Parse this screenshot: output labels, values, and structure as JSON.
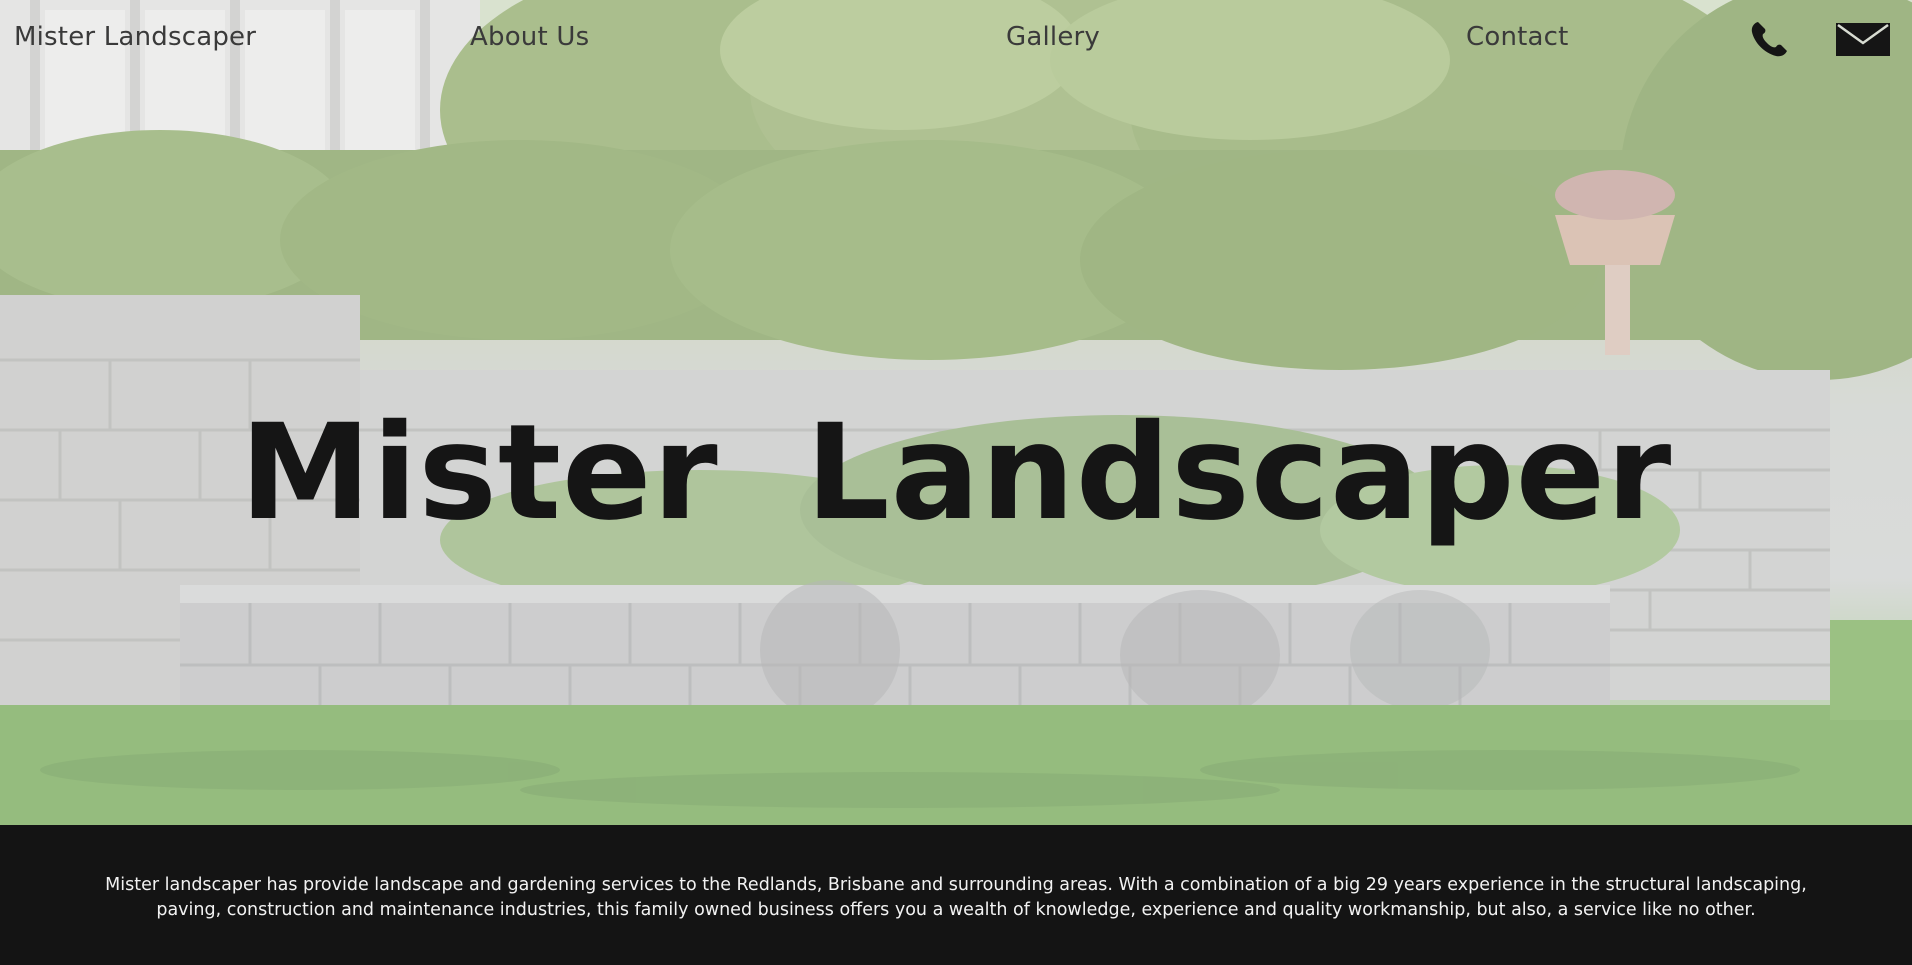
{
  "nav": {
    "brand": "Mister Landscaper",
    "links": [
      "About Us",
      "Gallery",
      "Contact"
    ],
    "icons": [
      "phone-icon",
      "mail-icon"
    ]
  },
  "hero": {
    "title": "Mister Landscaper",
    "background": "landscaped garden with grey block retaining walls, shrubs, trees and lawn"
  },
  "about": {
    "text": "Mister landscaper has provide landscape and gardening services to the Redlands, Brisbane and surrounding areas. With a combination of a big 29 years experience in the structural landscaping, paving, construction and maintenance industries, this family owned business offers you a wealth of knowledge, experience and quality workmanship, but also, a service like no other."
  },
  "colors": {
    "nav_text": "#3a3a3a",
    "title_text": "#151515",
    "footer_bg": "#141414",
    "footer_text": "#f2f2f2"
  }
}
